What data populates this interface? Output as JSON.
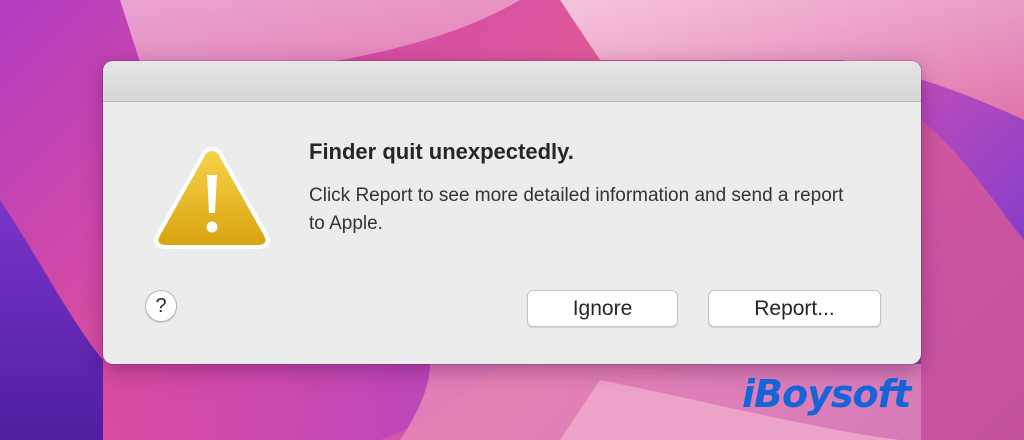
{
  "colors": {
    "dialog_background": "#ececec",
    "warning_icon": "#e8b81a",
    "watermark": "#1565d8"
  },
  "dialog": {
    "icon": "warning-triangle-icon",
    "title": "Finder quit unexpectedly.",
    "message": "Click Report to see more detailed information and send a report to Apple.",
    "help_label": "?",
    "buttons": {
      "ignore": "Ignore",
      "report": "Report..."
    }
  },
  "watermark": {
    "text": "iBoysoft"
  }
}
